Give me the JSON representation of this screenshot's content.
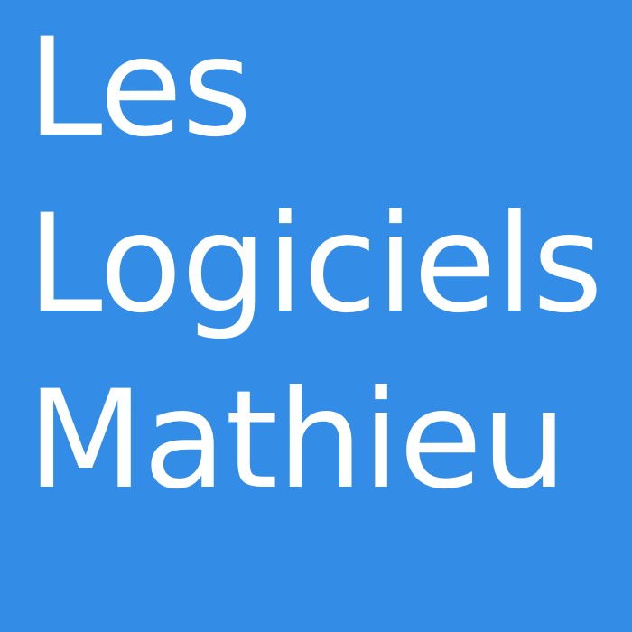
{
  "tile": {
    "background_color": "#338ce6",
    "text_color": "#ffffff",
    "lines": [
      "Les",
      "Logiciels",
      "Mathieu"
    ]
  }
}
